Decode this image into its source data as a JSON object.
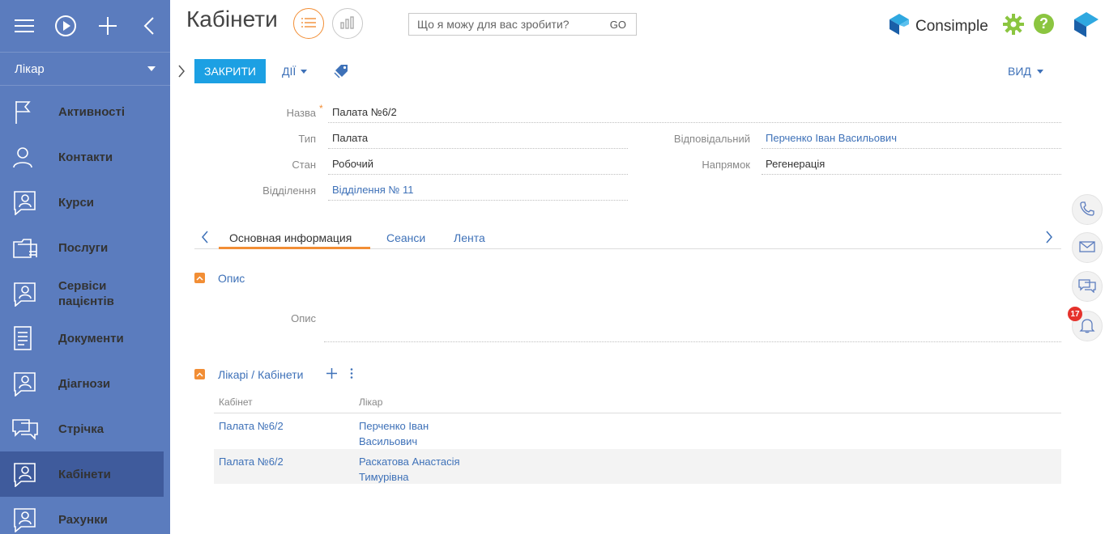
{
  "sidebar": {
    "workplace": "Лікар",
    "items": [
      {
        "label": "Активності"
      },
      {
        "label": "Контакти"
      },
      {
        "label": "Курси"
      },
      {
        "label": "Послуги"
      },
      {
        "label": "Сервіси пацієнтів"
      },
      {
        "label": "Документи"
      },
      {
        "label": "Діагнози"
      },
      {
        "label": "Стрічка"
      },
      {
        "label": "Кабінети",
        "active": true
      },
      {
        "label": "Рахунки"
      }
    ]
  },
  "header": {
    "title": "Кабінети",
    "command_placeholder": "Що я можу для вас зробити?",
    "command_go": "GO",
    "brand": "Consimple",
    "help": "?"
  },
  "actions": {
    "close": "ЗАКРИТИ",
    "actions": "ДІЇ",
    "view": "ВИД"
  },
  "fields": {
    "name": {
      "label": "Назва",
      "value": "Палата №6/2"
    },
    "type": {
      "label": "Тип",
      "value": "Палата"
    },
    "state": {
      "label": "Стан",
      "value": "Робочий"
    },
    "department": {
      "label": "Відділення",
      "value": "Відділення № 11"
    },
    "responsible": {
      "label": "Відповідальний",
      "value": "Перченко Іван Васильович"
    },
    "direction": {
      "label": "Напрямок",
      "value": "Регенерація"
    }
  },
  "tabs": [
    "Основная информация",
    "Сеанси",
    "Лента"
  ],
  "description_group": {
    "title": "Опис",
    "field_label": "Опис"
  },
  "doctors_group": {
    "title": "Лікарі / Кабінети",
    "columns": [
      "Кабінет",
      "Лікар"
    ],
    "rows": [
      {
        "cabinet": "Палата №6/2",
        "doctor_line1": "Перченко Іван",
        "doctor_line2": "Васильович"
      },
      {
        "cabinet": "Палата №6/2",
        "doctor_line1": "Раскатова Анастасія",
        "doctor_line2": "Тимурівна"
      }
    ]
  },
  "notifications": {
    "count": "17"
  },
  "colors": {
    "sidebar": "#5b7cbe",
    "sidebar_active": "#3f5b9c",
    "primary_button": "#1ca0e3",
    "accent": "#f28e35",
    "link": "#3e71b8"
  }
}
